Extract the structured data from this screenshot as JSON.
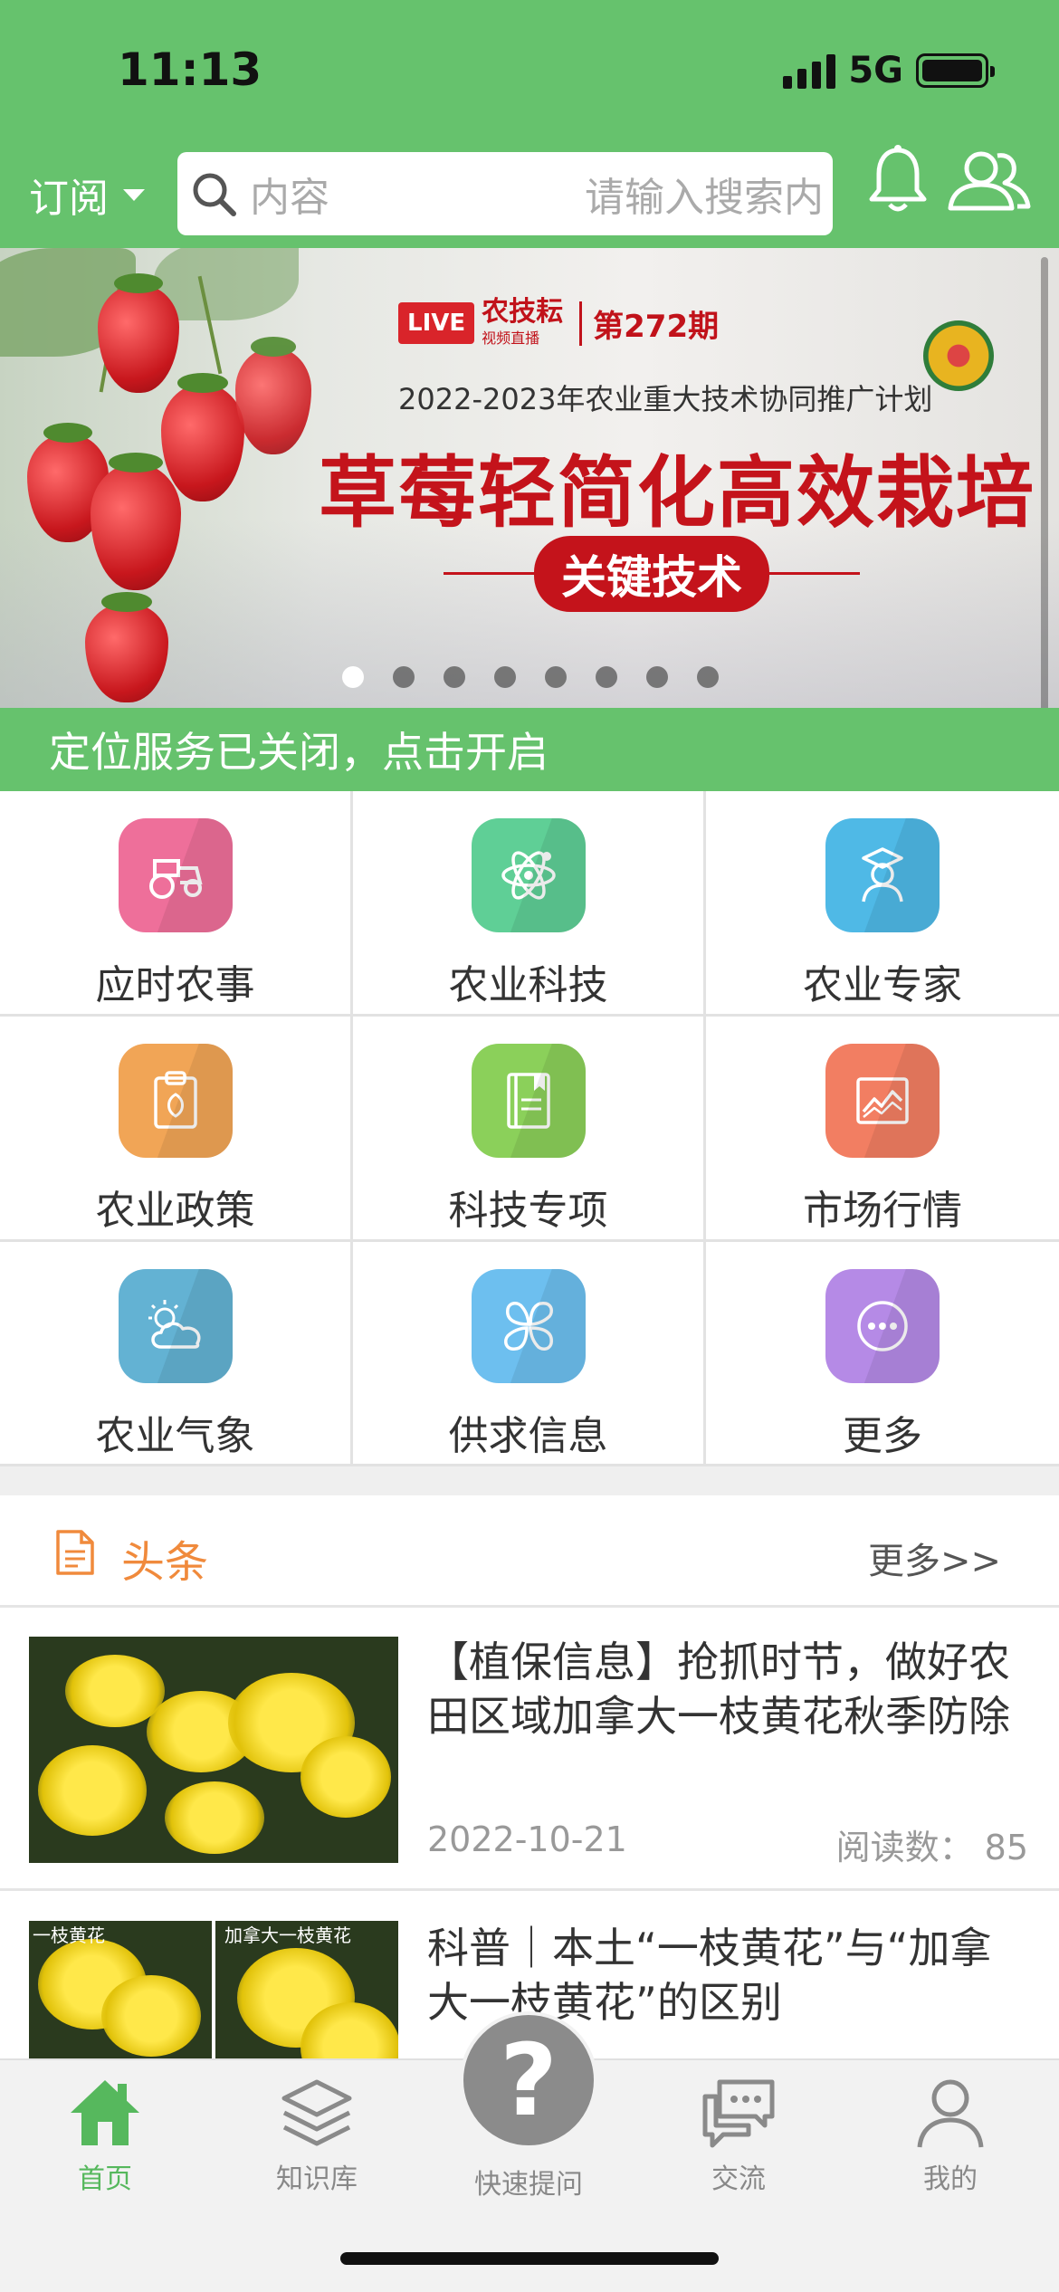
{
  "status_bar": {
    "time": "11:13",
    "network": "5G"
  },
  "header": {
    "subscribe_label": "订阅",
    "search_placeholder_left": "内容",
    "search_placeholder_right": "请输入搜索内"
  },
  "banner": {
    "live_tag": "LIVE",
    "brand": "农技耘",
    "brand_sub": "视频直播",
    "issue": "第272期",
    "subtitle": "2022-2023年农业重大技术协同推广计划",
    "title": "草莓轻简化高效栽培",
    "key_label": "关键技术",
    "slide_count": 8,
    "active_slide": 1
  },
  "location_notice": "定位服务已关闭，点击开启",
  "grid": [
    {
      "label": "应时农事",
      "icon": "tractor-icon",
      "color": "#ee6f9a"
    },
    {
      "label": "农业科技",
      "icon": "atom-icon",
      "color": "#5fcf96"
    },
    {
      "label": "农业专家",
      "icon": "expert-icon",
      "color": "#4fb9e6"
    },
    {
      "label": "农业政策",
      "icon": "clipboard-icon",
      "color": "#f1a556"
    },
    {
      "label": "科技专项",
      "icon": "book-icon",
      "color": "#8bd05a"
    },
    {
      "label": "市场行情",
      "icon": "chart-icon",
      "color": "#f27e62"
    },
    {
      "label": "农业气象",
      "icon": "weather-icon",
      "color": "#63b2d3"
    },
    {
      "label": "供求信息",
      "icon": "clover-icon",
      "color": "#6dbfef"
    },
    {
      "label": "更多",
      "icon": "more-icon",
      "color": "#b58ae6"
    }
  ],
  "news": {
    "section_title": "头条",
    "more_label": "更多>>",
    "items": [
      {
        "title": "【植保信息】抢抓时节，做好农田区域加拿大一枝黄花秋季防除",
        "date": "2022-10-21",
        "reads": "阅读数：  85"
      },
      {
        "title": "科普｜本土“一枝黄花”与“加拿大一枝黄花”的区别",
        "thumb_caption_left": "一枝黄花",
        "thumb_caption_right": "加拿大一枝黄花"
      }
    ]
  },
  "bottom_nav": {
    "items": [
      {
        "label": "首页",
        "icon": "home-icon",
        "active": true
      },
      {
        "label": "知识库",
        "icon": "layers-icon",
        "active": false
      },
      {
        "label": "快速提问",
        "icon": "question-icon",
        "active": false
      },
      {
        "label": "交流",
        "icon": "chat-icon",
        "active": false
      },
      {
        "label": "我的",
        "icon": "person-icon",
        "active": false
      }
    ]
  },
  "colors": {
    "brand_green": "#66c26d",
    "accent_orange": "#f08a3c",
    "banner_red": "#c4131b"
  }
}
